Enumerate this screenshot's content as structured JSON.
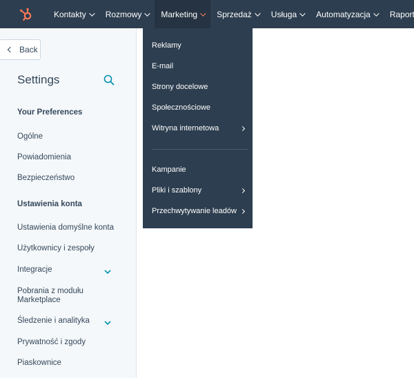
{
  "nav": {
    "items": [
      {
        "label": "Kontakty"
      },
      {
        "label": "Rozmowy"
      },
      {
        "label": "Marketing"
      },
      {
        "label": "Sprzedaż"
      },
      {
        "label": "Usługa"
      },
      {
        "label": "Automatyzacja"
      },
      {
        "label": "Raporty"
      }
    ],
    "active_index": 2
  },
  "sidebar": {
    "back_label": "Back",
    "title": "Settings",
    "sections": [
      {
        "heading": "Your Preferences",
        "items": [
          {
            "label": "Ogólne"
          },
          {
            "label": "Powiadomienia"
          },
          {
            "label": "Bezpieczeństwo"
          }
        ]
      },
      {
        "heading": "Ustawienia konta",
        "items": [
          {
            "label": "Ustawienia domyślne konta"
          },
          {
            "label": "Użytkownicy i zespoły"
          },
          {
            "label": "Integracje",
            "expandable": true
          },
          {
            "label": "Pobrania z modułu Marketplace"
          },
          {
            "label": "Śledzenie i analityka",
            "expandable": true
          },
          {
            "label": "Prywatność i zgody"
          },
          {
            "label": "Piaskownice"
          }
        ]
      }
    ]
  },
  "dropdown": {
    "group1": [
      {
        "label": "Reklamy"
      },
      {
        "label": "E-mail"
      },
      {
        "label": "Strony docelowe"
      },
      {
        "label": "Społecznościowe"
      },
      {
        "label": "Witryna internetowa",
        "submenu": true
      }
    ],
    "group2": [
      {
        "label": "Kampanie"
      },
      {
        "label": "Pliki i szablony",
        "submenu": true
      },
      {
        "label": "Przechwytywanie leadów",
        "submenu": true
      }
    ]
  },
  "colors": {
    "nav_bg": "#2d3e50",
    "accent": "#ff7a59",
    "link_accent": "#0091ae"
  }
}
